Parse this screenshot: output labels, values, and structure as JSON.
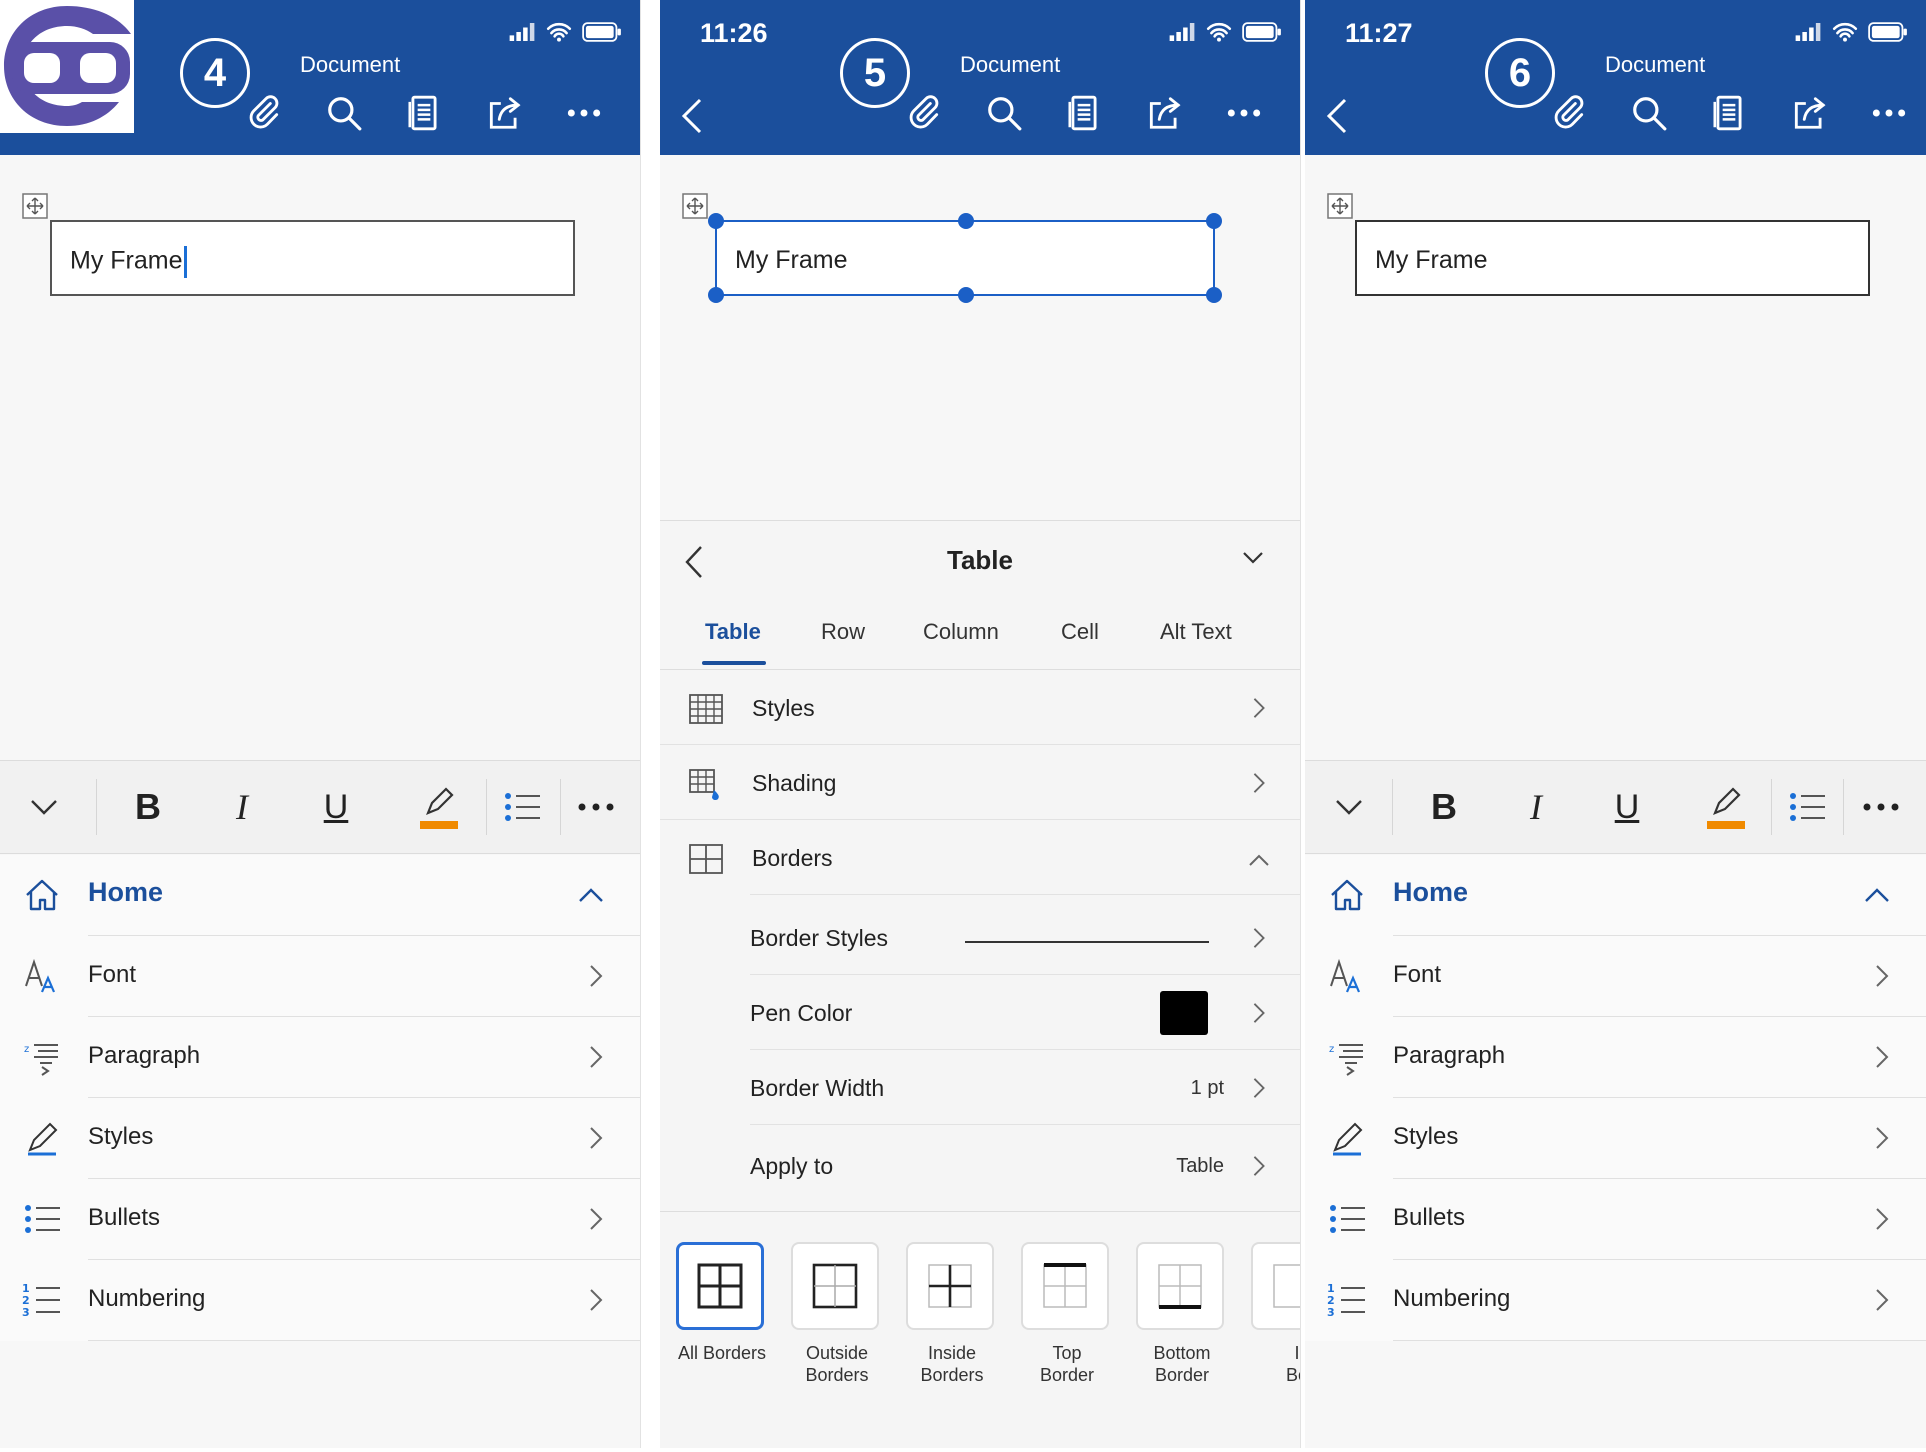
{
  "colors": {
    "header": "#1b4f9c",
    "accent": "#1b5fc6",
    "highlight": "#f08a00"
  },
  "panels": [
    {
      "step": "4",
      "time": "",
      "doc_title": "Document",
      "frame_text": "My Frame",
      "menu": [
        {
          "label": "Home",
          "icon": "home-icon"
        },
        {
          "label": "Font",
          "icon": "font-icon"
        },
        {
          "label": "Paragraph",
          "icon": "paragraph-icon"
        },
        {
          "label": "Styles",
          "icon": "pen-icon"
        },
        {
          "label": "Bullets",
          "icon": "bullets-icon"
        },
        {
          "label": "Numbering",
          "icon": "numbering-icon"
        }
      ]
    },
    {
      "step": "5",
      "time": "11:26",
      "doc_title": "Document",
      "frame_text": "My Frame",
      "sheet": {
        "title": "Table",
        "tabs": [
          "Table",
          "Row",
          "Column",
          "Cell",
          "Alt Text"
        ],
        "rows": [
          {
            "label": "Styles"
          },
          {
            "label": "Shading"
          },
          {
            "label": "Borders"
          }
        ],
        "subrows": [
          {
            "label": "Border Styles",
            "value": ""
          },
          {
            "label": "Pen Color",
            "value": ""
          },
          {
            "label": "Border Width",
            "value": "1 pt"
          },
          {
            "label": "Apply to",
            "value": "Table"
          }
        ],
        "border_options": [
          {
            "l1": "All Borders",
            "l2": ""
          },
          {
            "l1": "Outside",
            "l2": "Borders"
          },
          {
            "l1": "Inside",
            "l2": "Borders"
          },
          {
            "l1": "Top",
            "l2": "Border"
          },
          {
            "l1": "Bottom",
            "l2": "Border"
          },
          {
            "l1": "I",
            "l2": "Bo"
          }
        ]
      }
    },
    {
      "step": "6",
      "time": "11:27",
      "doc_title": "Document",
      "frame_text": "My Frame",
      "menu": [
        {
          "label": "Home",
          "icon": "home-icon"
        },
        {
          "label": "Font",
          "icon": "font-icon"
        },
        {
          "label": "Paragraph",
          "icon": "paragraph-icon"
        },
        {
          "label": "Styles",
          "icon": "pen-icon"
        },
        {
          "label": "Bullets",
          "icon": "bullets-icon"
        },
        {
          "label": "Numbering",
          "icon": "numbering-icon"
        }
      ]
    }
  ]
}
